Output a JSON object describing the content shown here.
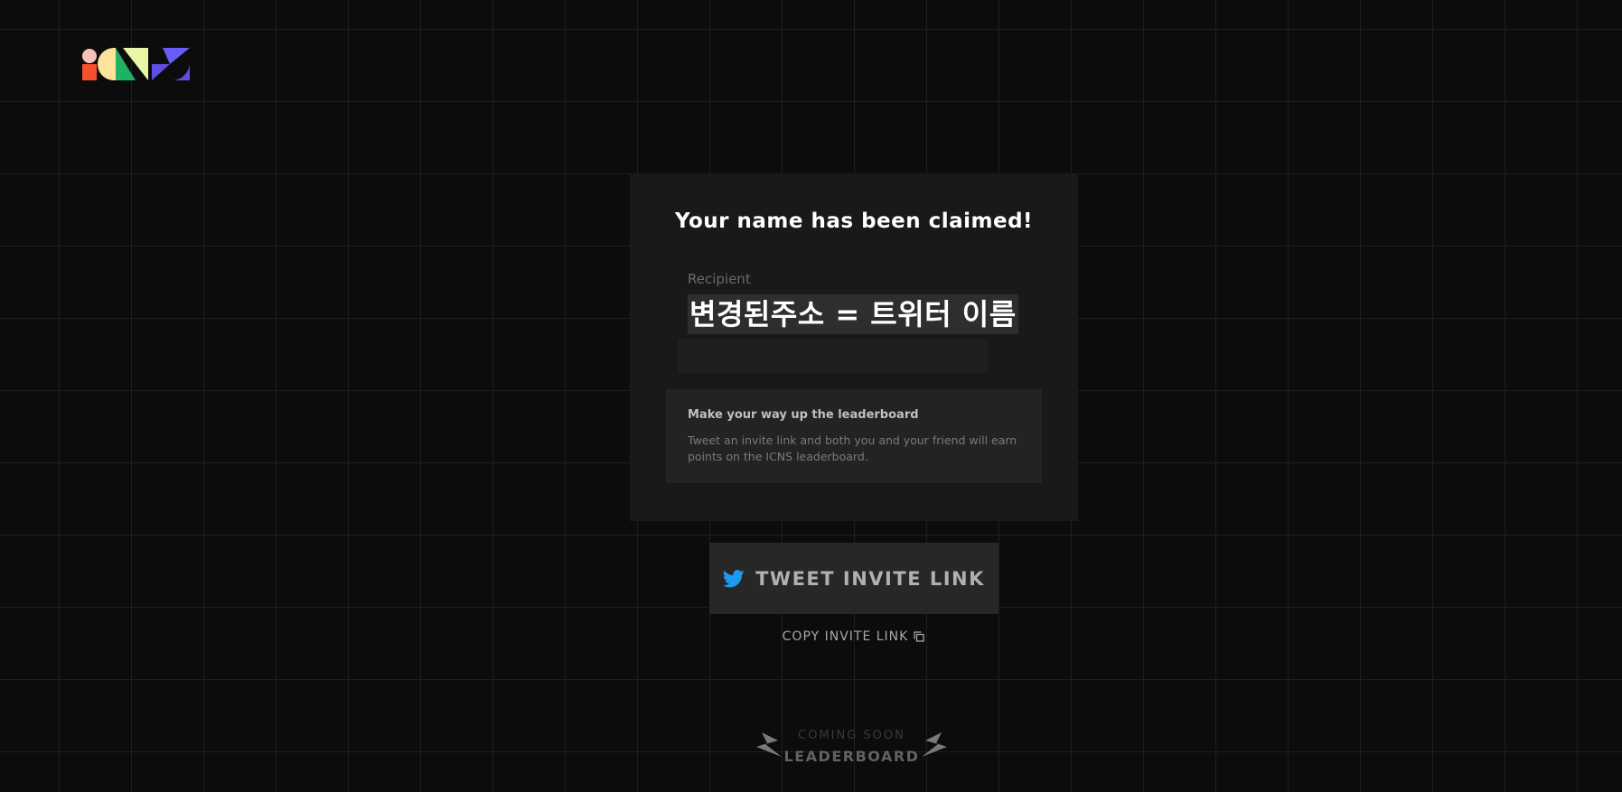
{
  "brand": {
    "logo_text": "ICNS",
    "colors": {
      "red": "#f54f2e",
      "peach": "#f8c1b8",
      "yellow": "#fde49a",
      "green": "#1fb262",
      "lime": "#e8f6a8",
      "purple": "#5e4ee6",
      "blue": "#6a5cf6"
    }
  },
  "card": {
    "title": "Your name has been claimed!",
    "recipient_label": "Recipient",
    "recipient_value": "변경된주소 = 트위터 이름",
    "info": {
      "title": "Make your way up the leaderboard",
      "description": "Tweet an invite link and both you and your friend will earn points on the ICNS leaderboard."
    }
  },
  "actions": {
    "tweet_label": "TWEET INVITE LINK",
    "tweet_icon": "twitter-icon",
    "twitter_color": "#1d9bf0",
    "copy_label": "COPY INVITE LINK",
    "copy_icon": "copy-icon"
  },
  "leaderboard": {
    "soon_label": "COMING SOON",
    "title": "LEADERBOARD",
    "icon": "lightning-bolt-icon"
  }
}
